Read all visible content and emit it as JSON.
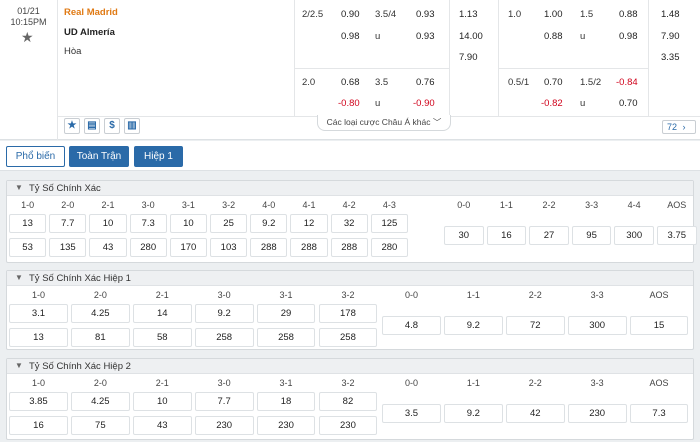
{
  "match": {
    "date": "01/21",
    "time": "10:15PM",
    "home_team": "Real Madrid",
    "away_team": "UD Almería",
    "draw_label": "Hòa",
    "more_bets_label": "Các loại cược Châu Á khác",
    "market_count": "72",
    "icons": [
      "star-icon",
      "scoreboard-icon",
      "dollar-icon",
      "stats-icon"
    ],
    "ft_handicap": {
      "line": "2/2.5",
      "home": "0.90",
      "away": "0.98"
    },
    "ft_ou": {
      "line": "3.5/4",
      "over": "0.93",
      "under_label": "u",
      "under": "0.93"
    },
    "ft_1x2": {
      "home": "1.13",
      "away": "14.00",
      "draw": "7.90"
    },
    "h1_handicap": {
      "line": "1.0",
      "home": "1.00",
      "away": "0.88"
    },
    "h1_ou": {
      "line": "1.5",
      "over": "0.88",
      "under_label": "u",
      "under": "0.98"
    },
    "h1_1x2": {
      "home": "1.48",
      "away": "7.90",
      "draw": "3.35"
    },
    "ft_handicap2": {
      "line": "2.0",
      "home": "0.68",
      "away": "-0.80"
    },
    "ft_ou2": {
      "line": "3.5",
      "over": "0.76",
      "under_label": "u",
      "under": "-0.90"
    },
    "h1_handicap2": {
      "line": "0.5/1",
      "home": "0.70",
      "away": "-0.82"
    },
    "h1_ou2": {
      "line": "1.5/2",
      "over": "-0.84",
      "under_label": "u",
      "under": "0.70"
    },
    "accent": "#e07a14",
    "negative_color": "#d0021b"
  },
  "tabs": [
    {
      "label": "Phổ biến",
      "active": true
    },
    {
      "label": "Toàn Trận",
      "active": false
    },
    {
      "label": "Hiệp 1",
      "active": false
    }
  ],
  "sections": [
    {
      "title": "Tỷ Số Chính Xác",
      "home_scores": [
        "1-0",
        "2-0",
        "2-1",
        "3-0",
        "3-1",
        "3-2",
        "4-0",
        "4-1",
        "4-2",
        "4-3"
      ],
      "home_top": [
        "13",
        "7.7",
        "10",
        "7.3",
        "10",
        "25",
        "9.2",
        "12",
        "32",
        "125"
      ],
      "home_bottom": [
        "53",
        "135",
        "43",
        "280",
        "170",
        "103",
        "288",
        "288",
        "288",
        "280"
      ],
      "draw_scores": [
        "0-0",
        "1-1",
        "2-2",
        "3-3",
        "4-4",
        "AOS"
      ],
      "draw_values": [
        "30",
        "16",
        "27",
        "95",
        "300",
        "3.75"
      ]
    },
    {
      "title": "Tỷ Số Chính Xác Hiệp 1",
      "home_scores": [
        "1-0",
        "2-0",
        "2-1",
        "3-0",
        "3-1",
        "3-2"
      ],
      "home_top": [
        "3.1",
        "4.25",
        "14",
        "9.2",
        "29",
        "178"
      ],
      "home_bottom": [
        "13",
        "81",
        "58",
        "258",
        "258",
        "258"
      ],
      "draw_scores": [
        "0-0",
        "1-1",
        "2-2",
        "3-3",
        "AOS"
      ],
      "draw_values": [
        "4.8",
        "9.2",
        "72",
        "300",
        "15"
      ]
    },
    {
      "title": "Tỷ Số Chính Xác Hiệp 2",
      "home_scores": [
        "1-0",
        "2-0",
        "2-1",
        "3-0",
        "3-1",
        "3-2"
      ],
      "home_top": [
        "3.85",
        "4.25",
        "10",
        "7.7",
        "18",
        "82"
      ],
      "home_bottom": [
        "16",
        "75",
        "43",
        "230",
        "230",
        "230"
      ],
      "draw_scores": [
        "0-0",
        "1-1",
        "2-2",
        "3-3",
        "AOS"
      ],
      "draw_values": [
        "3.5",
        "9.2",
        "42",
        "230",
        "7.3"
      ]
    }
  ]
}
